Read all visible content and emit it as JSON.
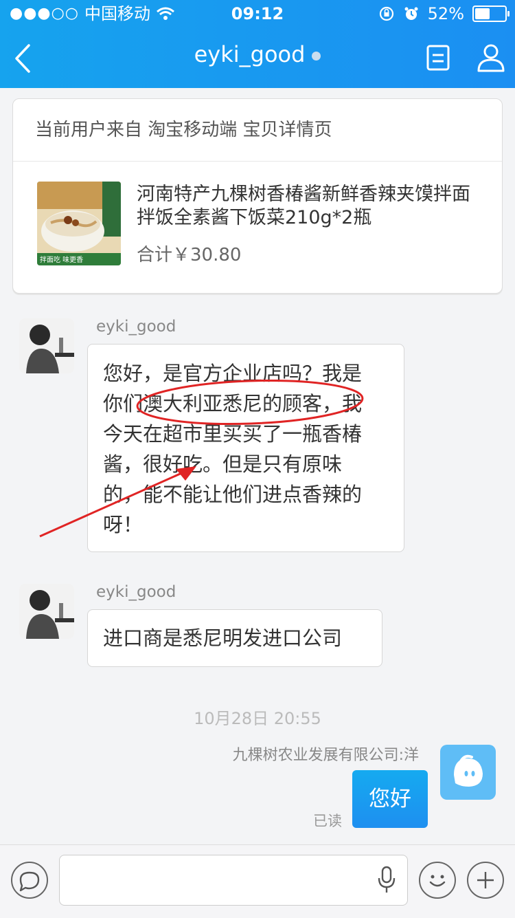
{
  "status_bar": {
    "carrier": "中国移动",
    "time": "09:12",
    "battery": "52%",
    "battery_level": 0.52
  },
  "nav": {
    "title": "eyki_good"
  },
  "product_card": {
    "source": "当前用户来自 淘宝移动端 宝贝详情页",
    "name": "河南特产九棵树香椿酱新鲜香辣夹馍拌面拌饭全素酱下饭菜210g*2瓶",
    "total": "合计￥30.80",
    "thumb_caption": "拌面吃 味更香"
  },
  "messages": [
    {
      "sender": "eyki_good",
      "text_lines": [
        "您好，是官方企业店吗？我是",
        "你们澳大利亚悉尼的顾客，我",
        "今天在超市里买买了一瓶香椿",
        "酱，很好吃。但是只有原味",
        "的，能不能让他们进点香辣的",
        "呀！"
      ]
    },
    {
      "sender": "eyki_good",
      "text": "进口商是悉尼明发进口公司"
    }
  ],
  "timestamp": "10月28日 20:55",
  "reply": {
    "agent_name": "九棵树农业发展有限公司:洋",
    "text": "您好",
    "read_status": "已读"
  },
  "colors": {
    "header": "#1b98f0",
    "annotation": "#e02424"
  }
}
